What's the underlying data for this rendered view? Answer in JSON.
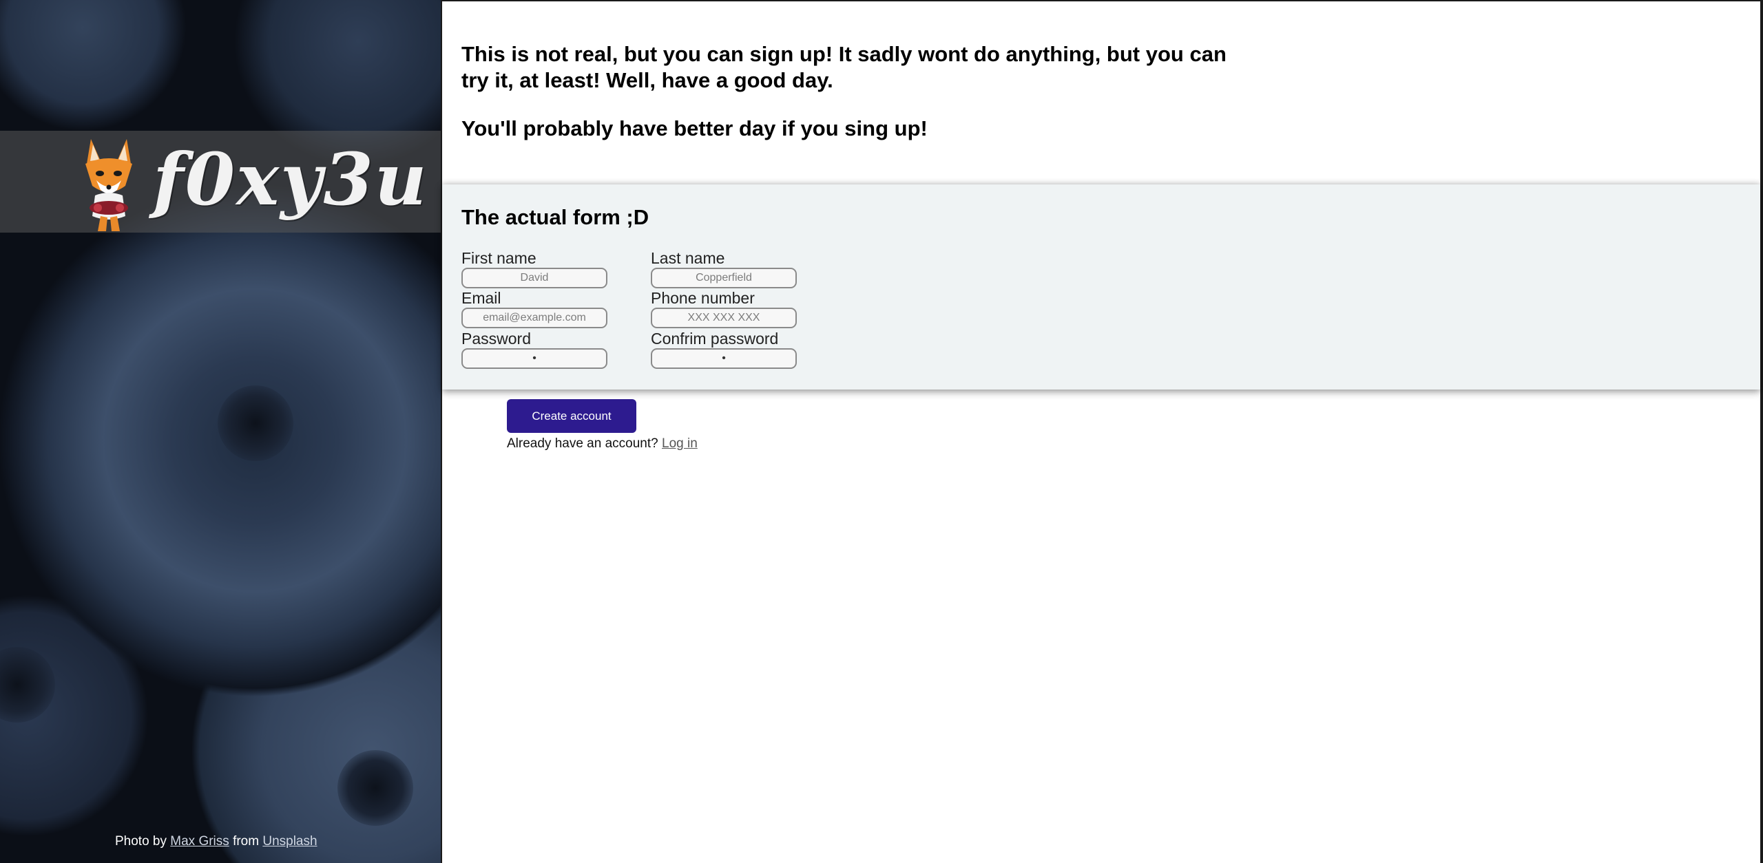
{
  "hero": {
    "logo_text": "f0xy3u",
    "credit_prefix": "Photo by",
    "credit_author": "Max Griss",
    "credit_mid": "from",
    "credit_site": "Unsplash"
  },
  "intro": {
    "line1": "This is not real, but you can sign up! It sadly wont do anything, but you can try it, at least! Well, have a good day.",
    "line2": "You'll probably have better day if you sing up!"
  },
  "form": {
    "title": "The actual form ;D",
    "first_name_label": "First name",
    "first_name_placeholder": "David",
    "last_name_label": "Last name",
    "last_name_placeholder": "Copperfield",
    "email_label": "Email",
    "email_placeholder": "email@example.com",
    "phone_label": "Phone number",
    "phone_placeholder": "XXX XXX XXX",
    "password_label": "Password",
    "password_value": "•",
    "confirm_label": "Confrim password",
    "confirm_value": "•"
  },
  "actions": {
    "create_label": "Create account",
    "login_prompt": "Already have an account?",
    "login_link": "Log in"
  },
  "colors": {
    "button": "#2d1b8f",
    "form_bg": "#eff3f4"
  },
  "icons": [
    "fox-mascot-icon"
  ]
}
